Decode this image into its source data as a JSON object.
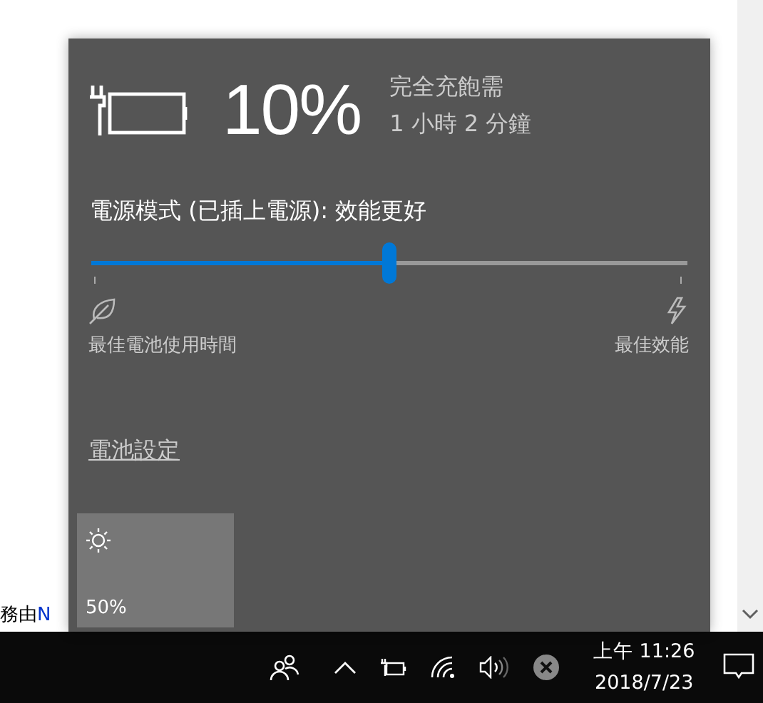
{
  "page": {
    "text": "務由",
    "link": "N"
  },
  "battery_flyout": {
    "plugged_in": true,
    "percent": "10%",
    "charge_time": [
      "完全充飽需",
      "1 小時 2 分鐘"
    ],
    "power_mode": {
      "label": "電源模式 (已插上電源): 效能更好",
      "level": 0.5,
      "left_label": "最佳電池使用時間",
      "right_label": "最佳效能"
    },
    "settings_link": "電池設定",
    "quick_actions": [
      {
        "kind": "brightness",
        "label": "50%"
      }
    ]
  },
  "taskbar": {
    "time": "上午 11:26",
    "date": "2018/7/23"
  }
}
